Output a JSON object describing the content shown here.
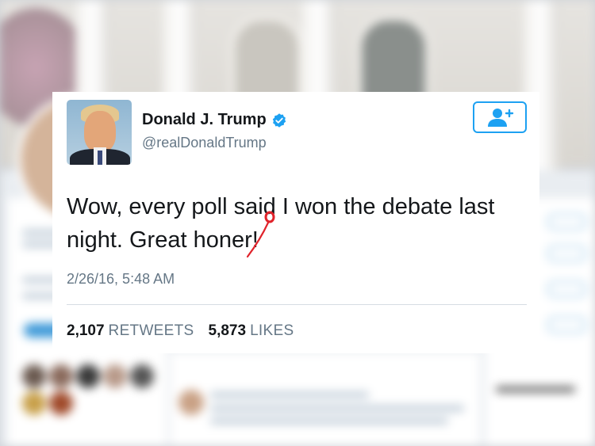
{
  "tweet": {
    "display_name": "Donald J. Trump",
    "handle": "@realDonaldTrump",
    "text_line1": "Wow, every poll said I won the debate last",
    "text_line2": "night. Great honer!",
    "timestamp": "2/26/16, 5:48 AM",
    "retweets_count": "2,107",
    "retweets_label": "RETWEETS",
    "likes_count": "5,873",
    "likes_label": "LIKES"
  },
  "icons": {
    "verified": "verified-badge-icon",
    "follow": "add-user-icon",
    "correction": "red-pen-correction-icon"
  },
  "colors": {
    "twitter_blue": "#1da1f2",
    "text_primary": "#14171a",
    "text_secondary": "#657786",
    "correction_red": "#e0232b"
  }
}
